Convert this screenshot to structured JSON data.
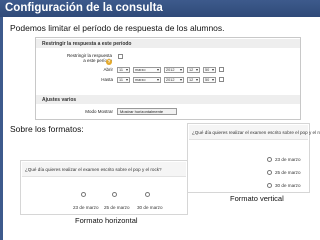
{
  "slide": {
    "title": "Configuración de la consulta",
    "intro": "Podemos limitar el período de respuesta de los alumnos.",
    "formats_label": "Sobre los formatos:"
  },
  "settings_panel": {
    "section_restrict": "Restringir la respuesta a este período",
    "restrict_label": "Restringir la respuesta a este período",
    "open_label": "Abrir",
    "close_label": "Hasta",
    "open_date": {
      "day": "11",
      "month": "marzo",
      "year": "2012",
      "hour": "12",
      "minute": "50"
    },
    "close_date": {
      "day": "11",
      "month": "marzo",
      "year": "2012",
      "hour": "12",
      "minute": "50"
    },
    "section_misc": "Ajustes varios",
    "display_mode_label": "Modo Mostrar",
    "display_mode_value": "Mostrar horizontalmente"
  },
  "question": "¿Qué día quieres realizar el examen escrito sobre el pop y el rock?",
  "options": [
    "23 de marzo",
    "25 de marzo",
    "30 de marzo"
  ],
  "captions": {
    "vertical": "Formato vertical",
    "horizontal": "Formato horizontal"
  },
  "colors": {
    "title_bar": "#3d5a8c",
    "help_icon": "#e4a92a"
  }
}
